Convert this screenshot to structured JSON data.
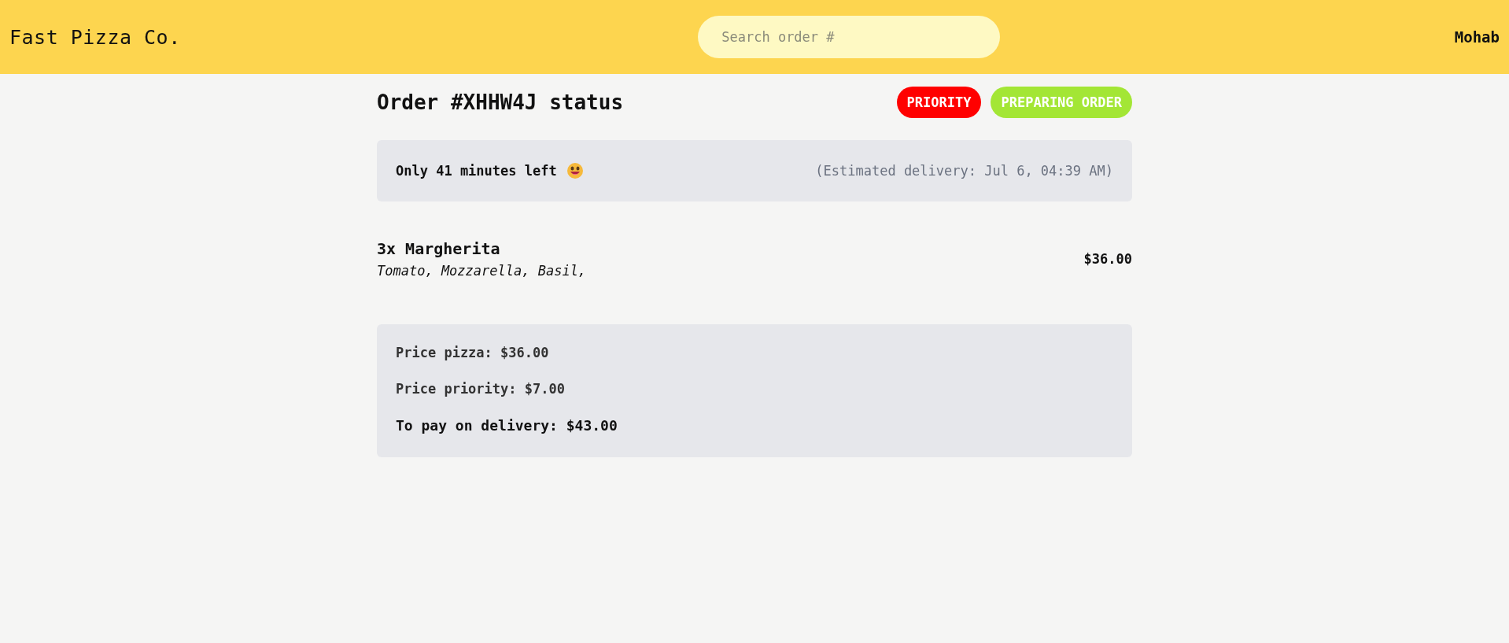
{
  "header": {
    "logo": "Fast Pizza Co.",
    "search": {
      "placeholder": "Search order #"
    },
    "user": "Mohab"
  },
  "order": {
    "title": "Order #XHHW4J status",
    "badges": [
      {
        "kind": "priority",
        "label": "PRIORITY"
      },
      {
        "kind": "status",
        "label": "PREPARING ORDER"
      }
    ],
    "countdown": "Only 41 minutes left",
    "estimate": "(Estimated delivery: Jul 6, 04:39 AM)",
    "items": [
      {
        "name": "3x Margherita",
        "ingredients": "Tomato, Mozzarella, Basil,",
        "price": "$36.00"
      }
    ],
    "summary": [
      {
        "kind": "line",
        "text": "Price pizza: $36.00"
      },
      {
        "kind": "line",
        "text": "Price priority: $7.00"
      },
      {
        "kind": "total",
        "text": "To pay on delivery: $43.00"
      }
    ]
  }
}
